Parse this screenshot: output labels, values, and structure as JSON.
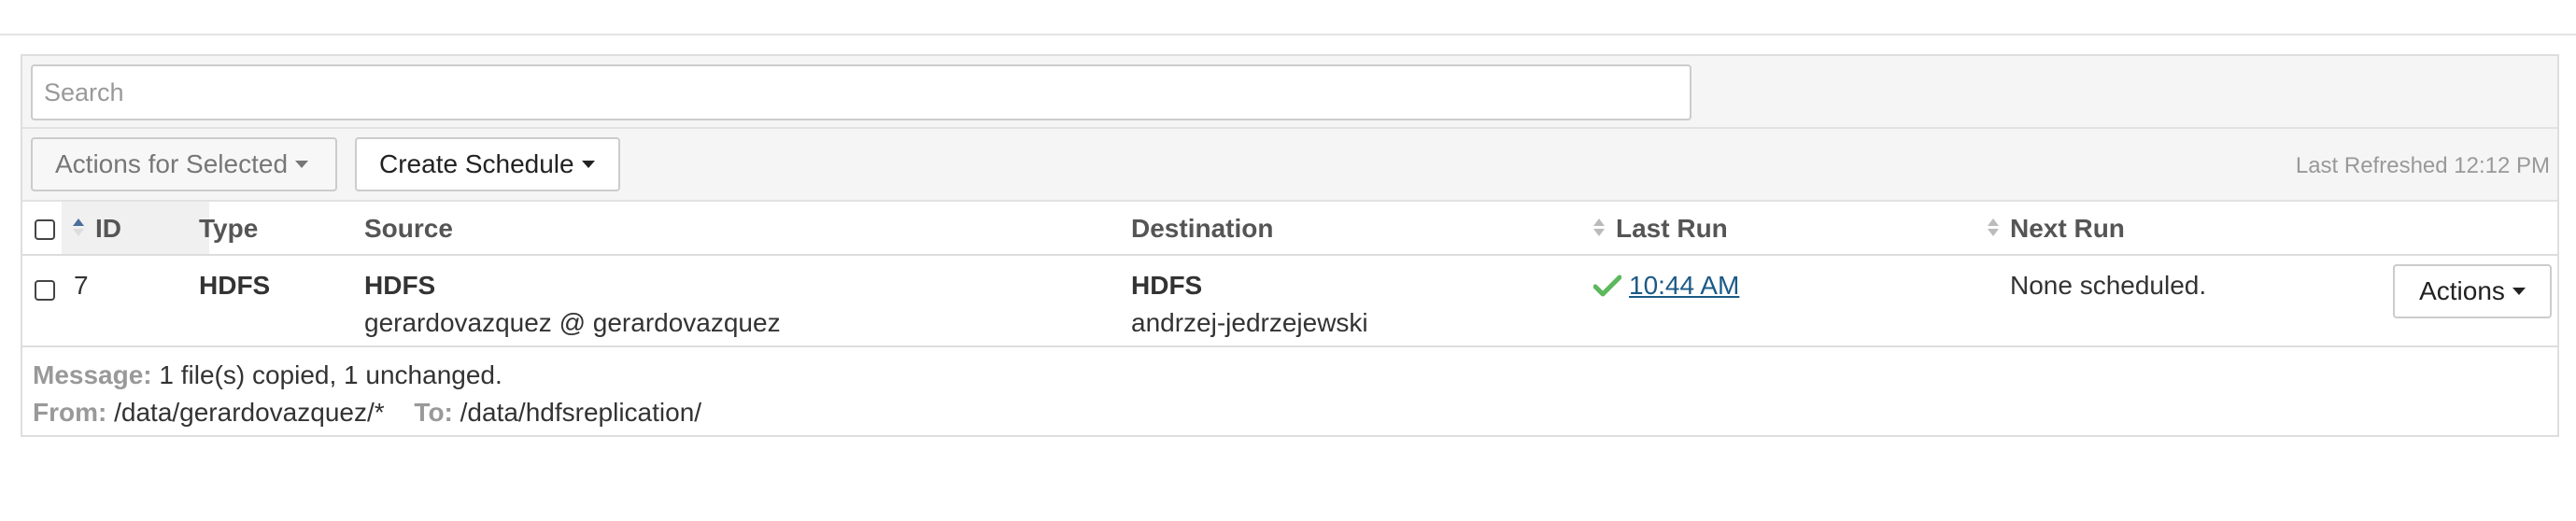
{
  "search": {
    "placeholder": "Search",
    "value": ""
  },
  "toolbar": {
    "actions_for_selected": "Actions for Selected",
    "create_schedule": "Create Schedule",
    "last_refreshed": "Last Refreshed 12:12 PM"
  },
  "table": {
    "headers": {
      "id": "ID",
      "type": "Type",
      "source": "Source",
      "destination": "Destination",
      "last_run": "Last Run",
      "next_run": "Next Run"
    },
    "rows": [
      {
        "id": "7",
        "type": "HDFS",
        "source_service": "HDFS",
        "source_cluster": "gerardovazquez @ gerardovazquez",
        "destination_service": "HDFS",
        "destination_cluster": "andrzej-jedrzejewski",
        "last_run": "10:44 AM",
        "last_run_status": "success",
        "next_run": "None scheduled.",
        "actions_label": "Actions",
        "message_label": "Message:",
        "message": "1 file(s) copied, 1 unchanged.",
        "from_label": "From:",
        "from": "/data/gerardovazquez/*",
        "to_label": "To:",
        "to": "/data/hdfsreplication/"
      }
    ]
  },
  "colors": {
    "success_check": "#5cb85c",
    "link": "#1b5a86",
    "muted_label": "#999999",
    "sort_active": "#4a6f9c"
  }
}
